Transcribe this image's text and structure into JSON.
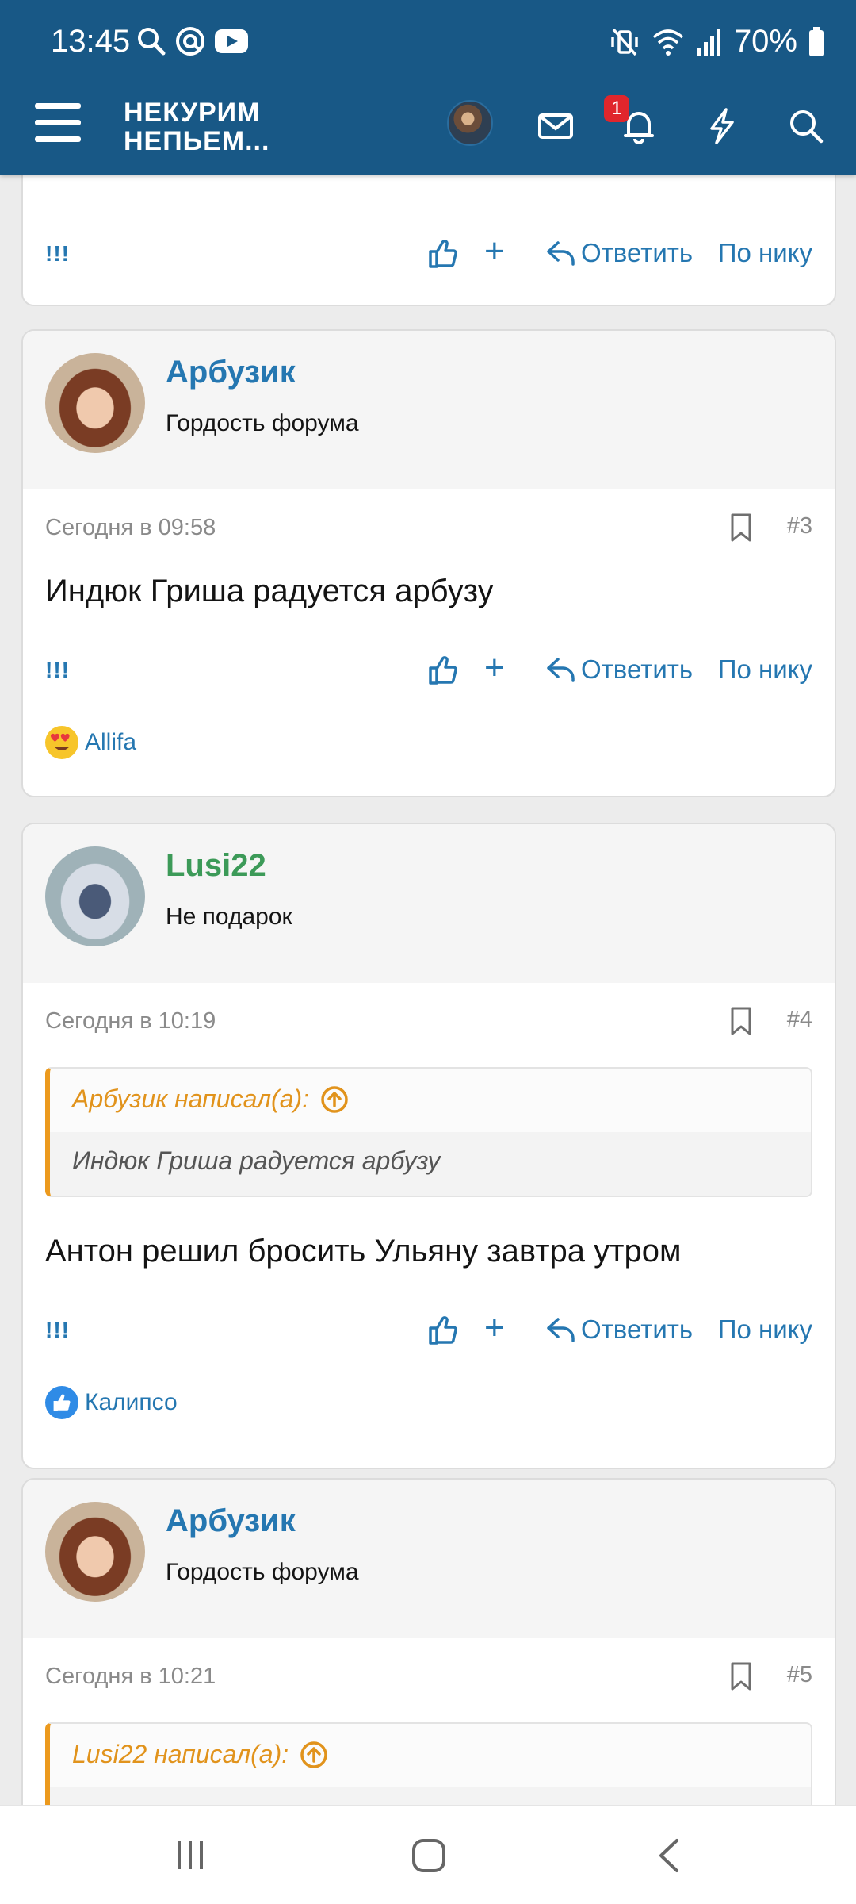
{
  "status": {
    "time": "13:45",
    "battery": "70%"
  },
  "header": {
    "logo_line1": "НЕКУРИМ",
    "logo_line2": "НЕПЬЕМ...",
    "notif_count": "1"
  },
  "actions": {
    "excl": "!!!",
    "plus": "+",
    "reply": "Ответить",
    "nick": "По нику"
  },
  "posts": [
    {
      "user": "Арбузик",
      "title": "Гордость форума",
      "date": "Сегодня в 09:58",
      "num": "#3",
      "text": "Индюк Гриша радуется арбузу",
      "reaction_user": "Allifa"
    },
    {
      "user": "Lusi22",
      "title": "Не подарок",
      "date": "Сегодня в 10:19",
      "num": "#4",
      "quote_author": "Арбузик написал(а):",
      "quote_text": "Индюк Гриша радуется арбузу",
      "text": "Антон решил бросить Ульяну завтра утром",
      "reaction_user": "Калипсо"
    },
    {
      "user": "Арбузик",
      "title": "Гордость форума",
      "date": "Сегодня в 10:21",
      "num": "#5",
      "quote_author": "Lusi22 написал(а):"
    }
  ],
  "colors": {
    "header": "#185886",
    "link": "#2577b1",
    "green_user": "#3c9a58",
    "quote_accent": "#ec9a1e"
  }
}
